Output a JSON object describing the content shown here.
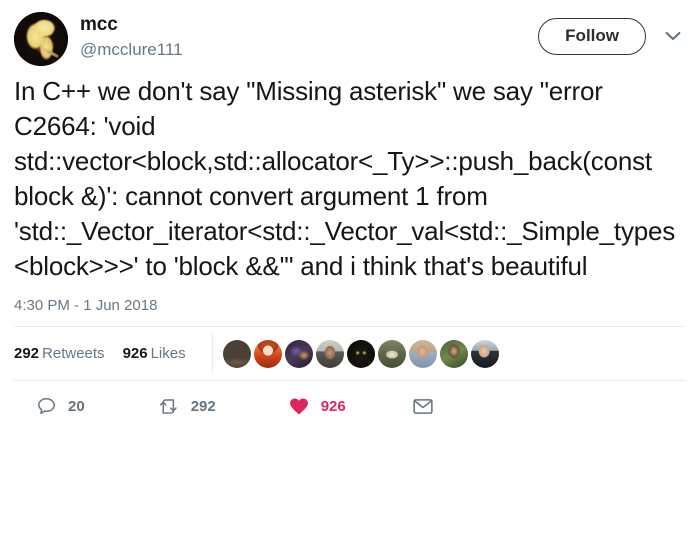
{
  "tweet": {
    "author": {
      "display_name": "mcc",
      "handle": "@mcclure111",
      "avatar_icon": "profile-avatar-image"
    },
    "follow_button_label": "Follow",
    "caret_icon": "chevron-down-icon",
    "body": "In C++ we don't say \"Missing asterisk\" we say \"error C2664: 'void std::vector<block,std::allocator<_Ty>>::push_back(const block &)': cannot convert argument 1 from 'std::_Vector_iterator<std::_Vector_val<std::_Simple_types<block>>>' to 'block &&'\" and i think that's beautiful",
    "timestamp": "4:30 PM - 1 Jun 2018",
    "stats": {
      "retweets_count": "292",
      "retweets_label": "Retweets",
      "likes_count": "926",
      "likes_label": "Likes"
    },
    "facepile": [
      "liker-avatar-1",
      "liker-avatar-2",
      "liker-avatar-3",
      "liker-avatar-4",
      "liker-avatar-5",
      "liker-avatar-6",
      "liker-avatar-7",
      "liker-avatar-8",
      "liker-avatar-9"
    ],
    "actions": {
      "reply_icon": "reply-bubble-icon",
      "reply_count": "20",
      "retweet_icon": "retweet-icon",
      "retweet_count": "292",
      "like_icon": "heart-filled-icon",
      "like_count": "926",
      "dm_icon": "envelope-icon"
    }
  },
  "colors": {
    "text": "#14171a",
    "muted": "#657786",
    "icon": "#66757f",
    "like_red": "#e0245e",
    "divider": "#e6ecf0",
    "chevron_blue": "#5b7083"
  }
}
